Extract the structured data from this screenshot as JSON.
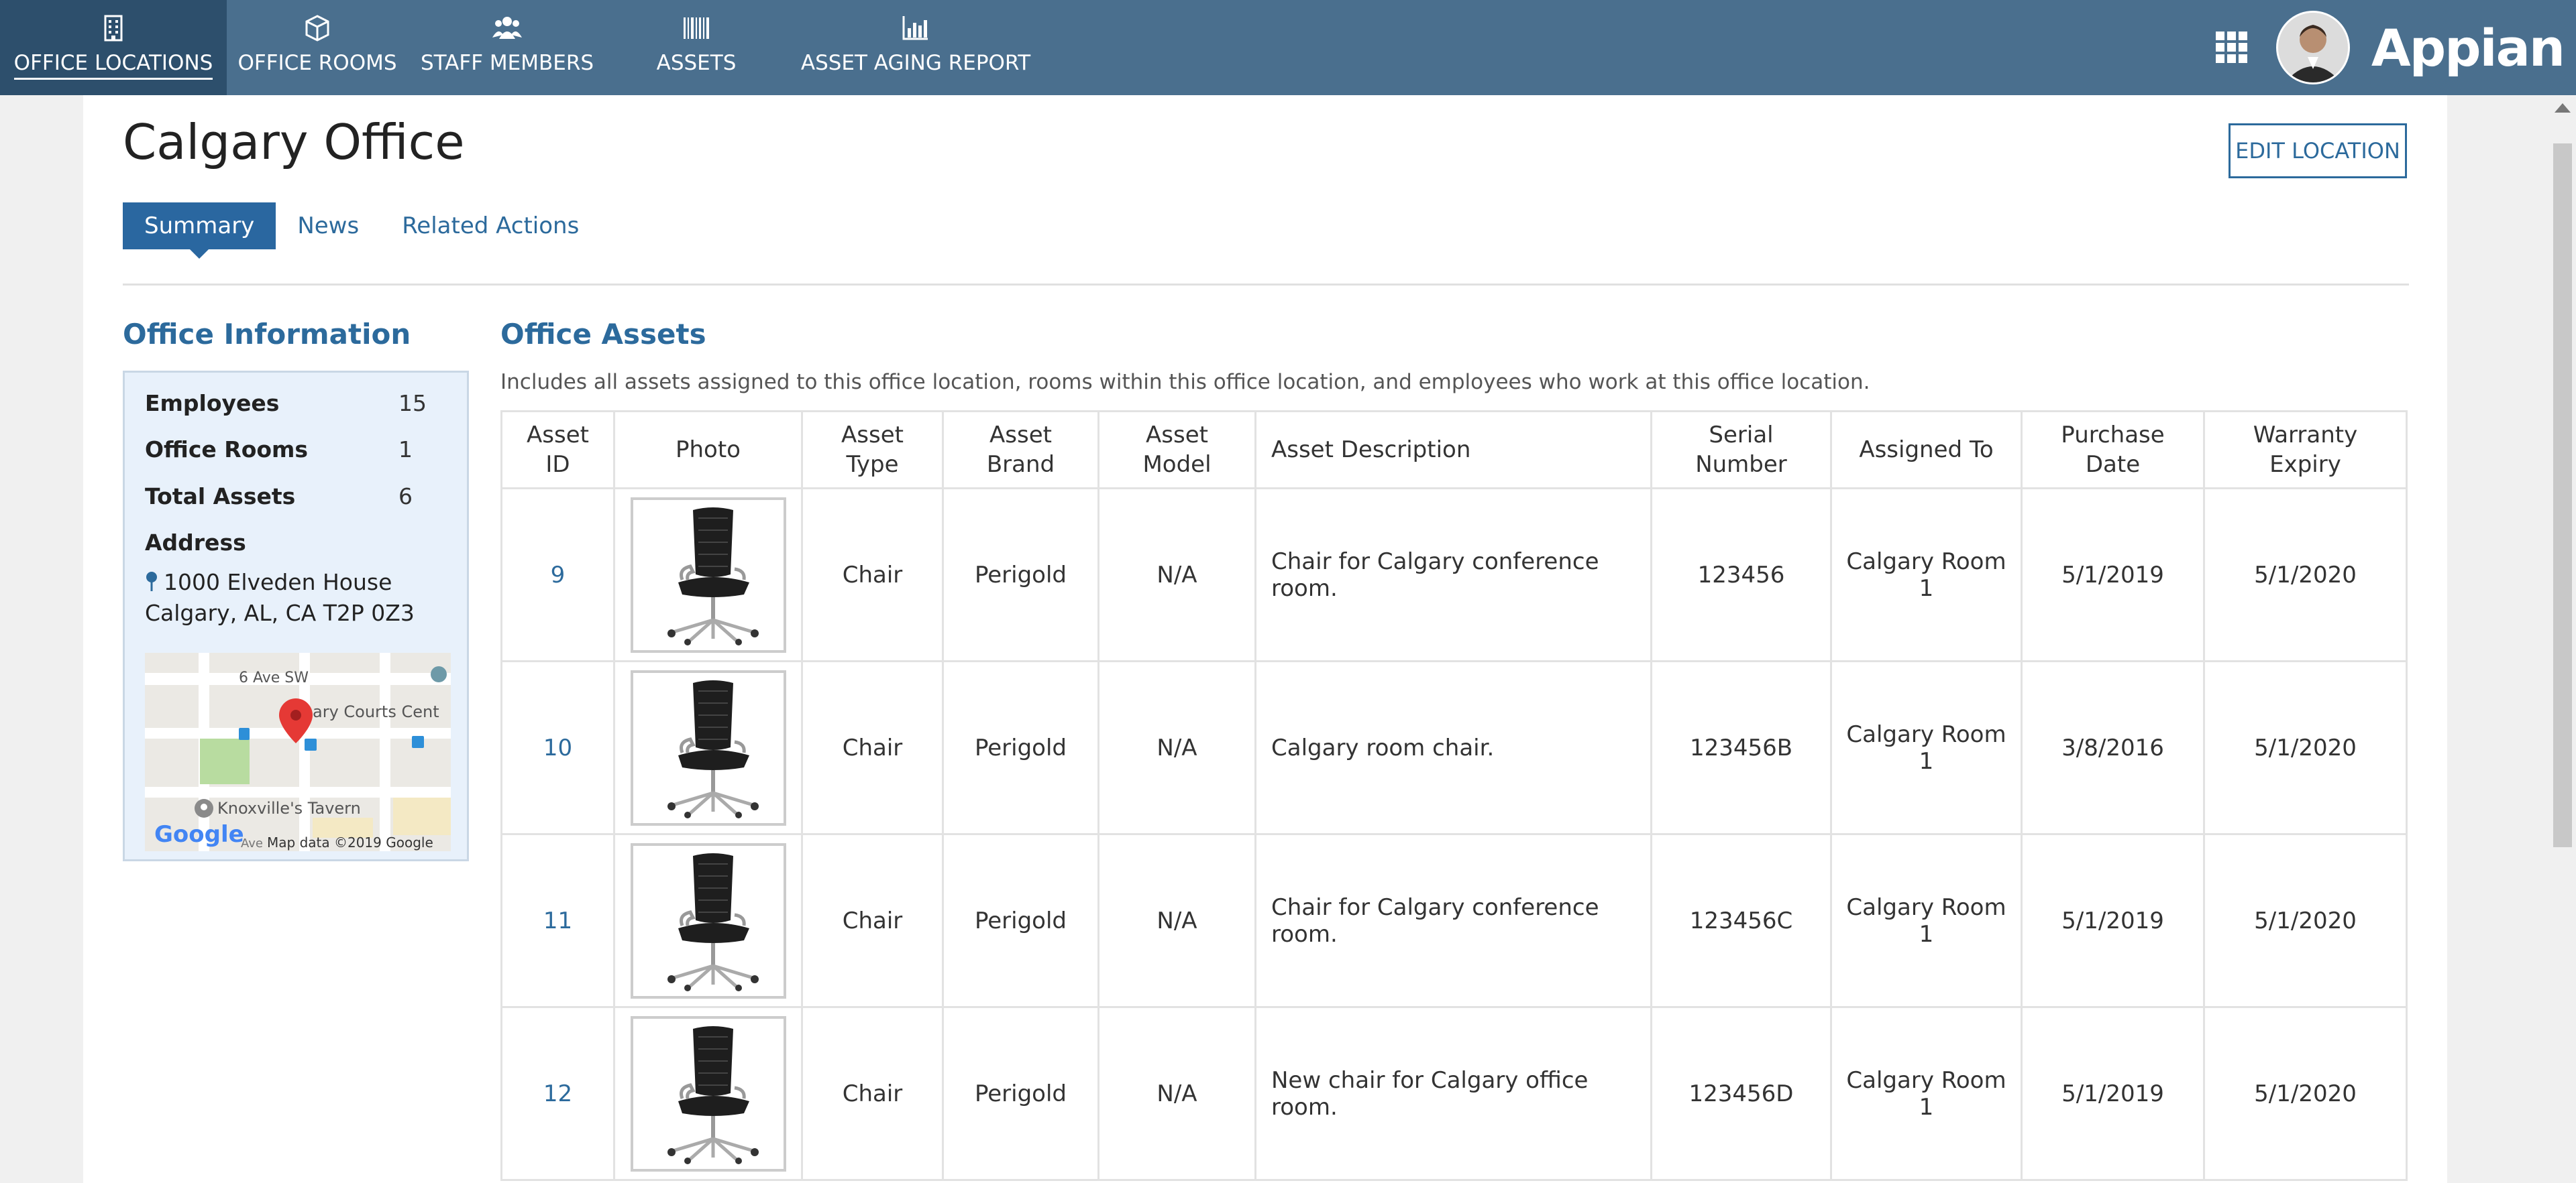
{
  "nav": {
    "tabs": [
      {
        "label": "OFFICE LOCATIONS",
        "icon": "building-icon",
        "active": true
      },
      {
        "label": "OFFICE ROOMS",
        "icon": "cube-icon"
      },
      {
        "label": "STAFF MEMBERS",
        "icon": "people-icon"
      },
      {
        "label": "ASSETS",
        "icon": "barcode-icon"
      },
      {
        "label": "ASSET AGING REPORT",
        "icon": "bar-chart-icon"
      }
    ],
    "brand": "Appian"
  },
  "page": {
    "title": "Calgary Office",
    "edit_button": "EDIT LOCATION",
    "tabs": [
      "Summary",
      "News",
      "Related Actions"
    ]
  },
  "office_info": {
    "title": "Office Information",
    "employees_label": "Employees",
    "employees": "15",
    "rooms_label": "Office Rooms",
    "rooms": "1",
    "assets_label": "Total Assets",
    "assets": "6",
    "address_label": "Address",
    "address_line1": "1000 Elveden House",
    "address_line2": "Calgary, AL, CA T2P 0Z3",
    "map": {
      "street1": "6 Ave SW",
      "poi1": "ary Courts Cent",
      "poi2": "Knoxville's Tavern",
      "street2": "Ave",
      "google": "Google",
      "copyright": "Map data ©2019 Google"
    }
  },
  "office_assets": {
    "title": "Office Assets",
    "description": "Includes all assets assigned to this office location, rooms within this office location, and employees who work at this office location.",
    "headers": {
      "id1": "Asset",
      "id2": "ID",
      "photo": "Photo",
      "type1": "Asset",
      "type2": "Type",
      "brand1": "Asset",
      "brand2": "Brand",
      "model1": "Asset",
      "model2": "Model",
      "desc": "Asset Description",
      "serial1": "Serial",
      "serial2": "Number",
      "assigned": "Assigned To",
      "purchase1": "Purchase",
      "purchase2": "Date",
      "warranty1": "Warranty",
      "warranty2": "Expiry"
    },
    "rows": [
      {
        "id": "9",
        "type": "Chair",
        "brand": "Perigold",
        "model": "N/A",
        "desc": "Chair for Calgary conference room.",
        "serial": "123456",
        "assigned1": "Calgary Room",
        "assigned2": "1",
        "purchase": "5/1/2019",
        "warranty": "5/1/2020"
      },
      {
        "id": "10",
        "type": "Chair",
        "brand": "Perigold",
        "model": "N/A",
        "desc": "Calgary room chair.",
        "serial": "123456B",
        "assigned1": "Calgary Room",
        "assigned2": "1",
        "purchase": "3/8/2016",
        "warranty": "5/1/2020"
      },
      {
        "id": "11",
        "type": "Chair",
        "brand": "Perigold",
        "model": "N/A",
        "desc": "Chair for Calgary conference room.",
        "serial": "123456C",
        "assigned1": "Calgary Room",
        "assigned2": "1",
        "purchase": "5/1/2019",
        "warranty": "5/1/2020"
      },
      {
        "id": "12",
        "type": "Chair",
        "brand": "Perigold",
        "model": "N/A",
        "desc": "New chair for Calgary office room.",
        "serial": "123456D",
        "assigned1": "Calgary Room",
        "assigned2": "1",
        "purchase": "5/1/2019",
        "warranty": "5/1/2020"
      }
    ]
  },
  "colors": {
    "topbar": "#4a6f8e",
    "topbar_active": "#2d4f6c",
    "link": "#2c6a9c",
    "info_bg": "#e8f1fb"
  }
}
